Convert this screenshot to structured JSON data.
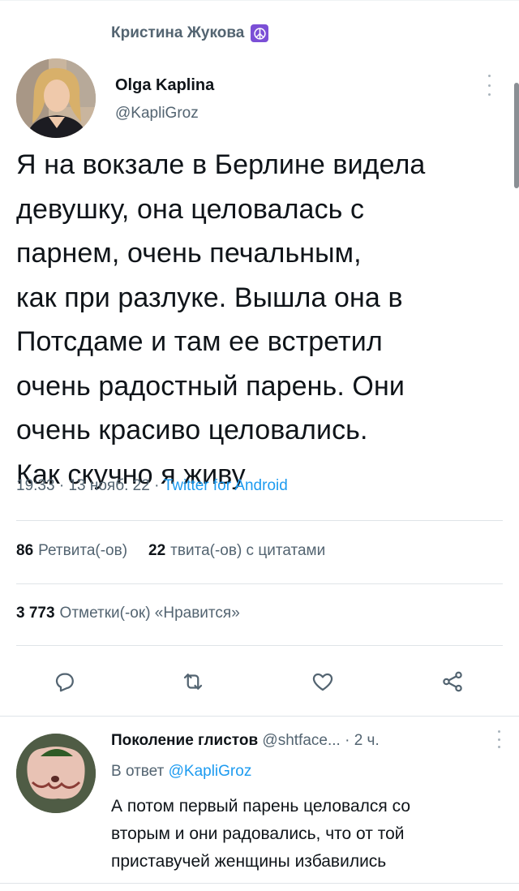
{
  "retweeter": {
    "name": "Кристина Жукова",
    "badge_icon": "peace-icon",
    "badge_color": "#7b4fd6"
  },
  "author": {
    "name": "Olga Kaplina",
    "handle": "@KapliGroz"
  },
  "tweet": {
    "lines": [
      "Я на вокзале в Берлине видела",
      "девушку, она целовалась с",
      "парнем, очень печальным,",
      "как при разлуке. Вышла она в",
      "Потсдаме и там ее встретил",
      "очень радостный парень. Они",
      "очень красиво целовались.",
      "Как скучно я живу"
    ],
    "time": "19:33",
    "date": "13 нояб. 22",
    "source": "Twitter for Android"
  },
  "stats": {
    "retweets_count": "86",
    "retweets_label": "Ретвита(-ов)",
    "quotes_count": "22",
    "quotes_label": "твита(-ов) с цитатами",
    "likes_count": "3 773",
    "likes_label": "Отметки(-ок) «Нравится»"
  },
  "actions": [
    "reply-icon",
    "retweet-icon",
    "like-icon",
    "share-icon"
  ],
  "reply": {
    "name": "Поколение глистов",
    "handle": "@shtface...",
    "time": "2 ч.",
    "reply_to_prefix": "В ответ",
    "reply_to_handle": "@KapliGroz",
    "lines": [
      "А потом первый парень целовался со",
      "вторым и они радовались, что от той",
      "приставучей женщины избавились"
    ]
  },
  "colors": {
    "link": "#1d9bf0",
    "secondary": "#536471",
    "text": "#0f1419"
  }
}
